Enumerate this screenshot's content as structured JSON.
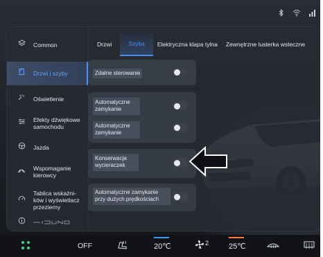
{
  "status": {
    "icons": [
      "bluetooth-icon",
      "wifi-icon",
      "signal-icon"
    ]
  },
  "sidebar": {
    "items": [
      {
        "label": "Common",
        "icon": "layers-icon"
      },
      {
        "label": "Drzwi i szyby",
        "icon": "door-icon",
        "active": true
      },
      {
        "label": "Oświetlenie",
        "icon": "light-icon"
      },
      {
        "label": "Efekty dźwiękowe samochodu",
        "icon": "sliders-icon"
      },
      {
        "label": "Jazda",
        "icon": "steering-wheel-icon"
      },
      {
        "label": "Wspomaganie kierowcy",
        "icon": "assist-icon"
      },
      {
        "label": "Tablica wskaźni-ków i wyświetlacz przezierny",
        "icon": "gauge-icon"
      },
      {
        "label": "",
        "icon": "info-icon"
      }
    ]
  },
  "tabs": [
    {
      "label": "Drzwi"
    },
    {
      "label": "Szyba",
      "active": true
    },
    {
      "label": "Elektryczna klapa tylna"
    },
    {
      "label": "Zewnętrzne lusterka wsteczne"
    }
  ],
  "settings": {
    "remote_control": {
      "label": "Zdalne sterowanie",
      "on": false
    },
    "auto_close_1": {
      "label": "Automatyczne zamykanie",
      "on": false
    },
    "auto_close_2": {
      "label": "Automatyczne zamykanie",
      "on": false
    },
    "wiper_maintenance": {
      "label": "Konserwacja wycieraczek",
      "on": false
    },
    "auto_close_speed": {
      "label": "Automatyczne zamykanie przy dużych prędkościach",
      "on": false
    }
  },
  "bottombar": {
    "ac_status": "OFF",
    "left_temp": "20℃",
    "fan_level": "2",
    "right_temp": "25℃"
  },
  "colors": {
    "accent": "#4b8df0",
    "panel": "#262a32",
    "left_temp_mark": "#3aa0ff",
    "right_temp_mark": "#ff7a3a",
    "home_icon": "#3fd08b"
  }
}
